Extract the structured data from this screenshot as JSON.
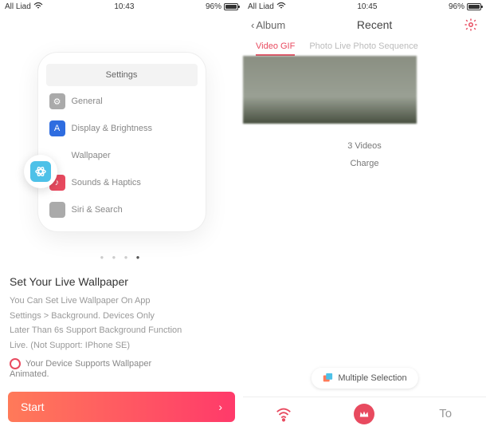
{
  "screen1": {
    "status": {
      "carrier": "All Liad",
      "time": "10:43",
      "battery": "96%"
    },
    "mock": {
      "header": "Settings",
      "items": [
        {
          "label": "General"
        },
        {
          "label": "Display & Brightness"
        },
        {
          "label": "Wallpaper"
        },
        {
          "label": "Sounds & Haptics"
        },
        {
          "label": "Siri & Search"
        }
      ]
    },
    "title": "Set Your Live Wallpaper",
    "desc1": "You Can Set Live Wallpaper On App",
    "desc2": "Settings > Background. Devices Only",
    "desc3": "Later Than 6s Support Background Function",
    "desc4": "Live. (Not Support: IPhone SE)",
    "support": "Your Device Supports Wallpaper",
    "support2": "Animated.",
    "start": "Start"
  },
  "screen2": {
    "status": {
      "carrier": "All Liad",
      "time": "10:45",
      "battery": "96%"
    },
    "nav": {
      "back": "Album",
      "title": "Recent"
    },
    "tabs": {
      "t1": "Video GIF",
      "t2": "Photo Live Photo Sequence"
    },
    "count": "3 Videos",
    "charge": "Charge",
    "multi": "Multiple Selection",
    "tool": "To"
  }
}
